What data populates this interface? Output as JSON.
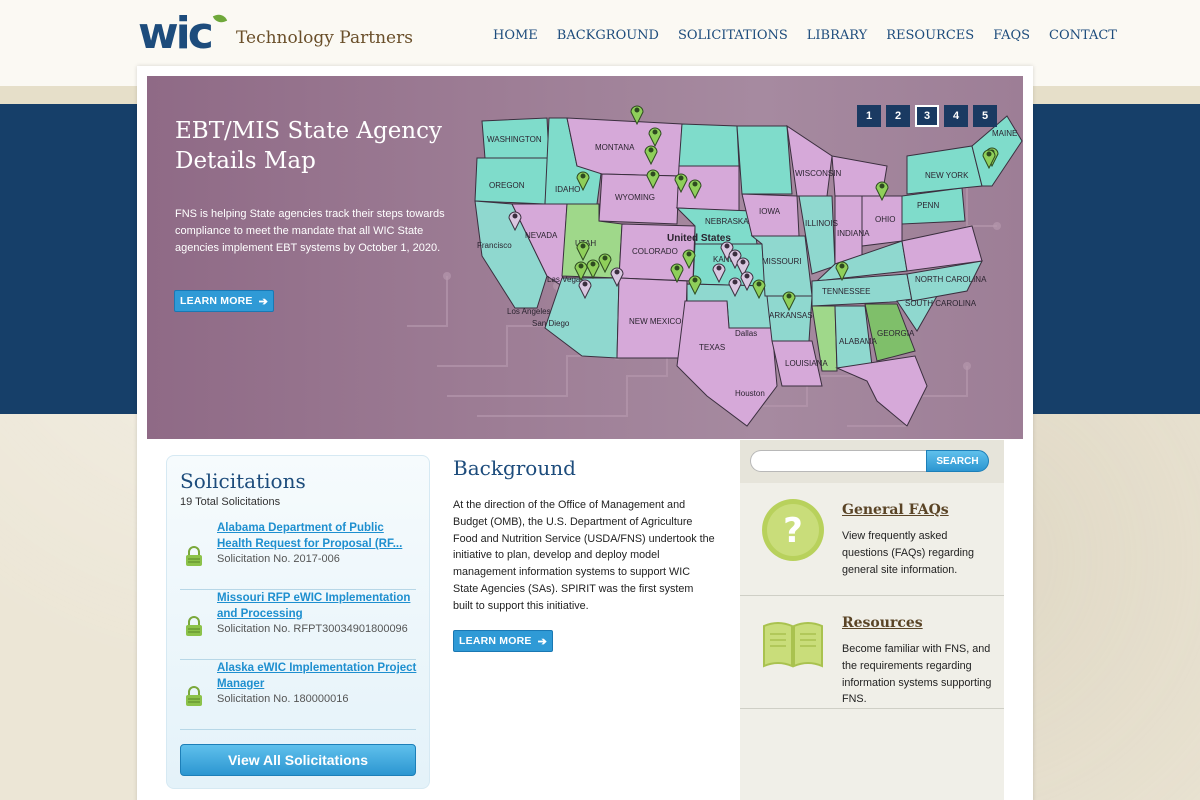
{
  "brand": {
    "logo_text": "wic",
    "name": "Technology Partners"
  },
  "nav": {
    "items": [
      "HOME",
      "BACKGROUND",
      "SOLICITATIONS",
      "LIBRARY",
      "RESOURCES",
      "FAQS",
      "CONTACT"
    ]
  },
  "hero": {
    "title": "EBT/MIS State Agency Details Map",
    "description": "FNS is helping State agencies track their steps towards compliance to meet the mandate that all WIC State agencies implement EBT systems by October 1, 2020.",
    "button_label": "LEARN MORE",
    "slides": [
      "1",
      "2",
      "3",
      "4",
      "5"
    ],
    "active_slide": "3",
    "map_labels": [
      "WASHINGTON",
      "MONTANA",
      "OREGON",
      "IDAHO",
      "WYOMING",
      "NEVADA",
      "UTAH",
      "COLORADO",
      "NEBRASKA",
      "KANSAS",
      "IOWA",
      "NEW MEXICO",
      "TEXAS",
      "MISSOURI",
      "ARKANSAS",
      "TENNESSEE",
      "ALABAMA",
      "GEORGIA",
      "INDIANA",
      "OHIO",
      "ILLINOIS",
      "WISCONSIN",
      "NEW YORK",
      "PENN",
      "MAINE",
      "United States",
      "Las Vegas",
      "Los Angeles",
      "San Diego",
      "Dallas",
      "Houston",
      "NORTH CAROLINA",
      "SOUTH CAROLINA",
      "LOUISIANA",
      "Francisco"
    ]
  },
  "solicitations": {
    "title": "Solicitations",
    "count_text": "19 Total Solicitations",
    "items": [
      {
        "title": "Alabama Department of Public Health Request for Proposal (RF...",
        "number": "Solicitation No. 2017-006"
      },
      {
        "title": "Missouri RFP eWIC Implementation and Processing",
        "number": "Solicitation No. RFPT30034901800096"
      },
      {
        "title": "Alaska eWIC Implementation Project Manager",
        "number": "Solicitation No. 180000016"
      }
    ],
    "view_all_label": "View All Solicitations"
  },
  "background": {
    "title": "Background",
    "text": "At the direction of the Office of Management and Budget (OMB), the U.S. Department of Agriculture Food and Nutrition Service (USDA/FNS) undertook the initiative to plan, develop and deploy model management information systems to support WIC State Agencies (SAs). SPIRIT was the first system built to support this initiative.",
    "button_label": "LEARN MORE"
  },
  "search": {
    "placeholder": "",
    "button_label": "SEARCH"
  },
  "features": [
    {
      "title": "General FAQs",
      "description": "View frequently asked questions (FAQs) regarding general site information.",
      "icon": "question-icon"
    },
    {
      "title": "Resources",
      "description": "Become familiar with FNS, and the requirements regarding information systems supporting FNS.",
      "icon": "book-icon"
    }
  ],
  "colors": {
    "brand_blue": "#1d4c7c",
    "accent_blue": "#2f9ad6",
    "hero_purple": "#9d7d95",
    "band_blue": "#163f69",
    "feature_green": "#b6cf5a"
  }
}
